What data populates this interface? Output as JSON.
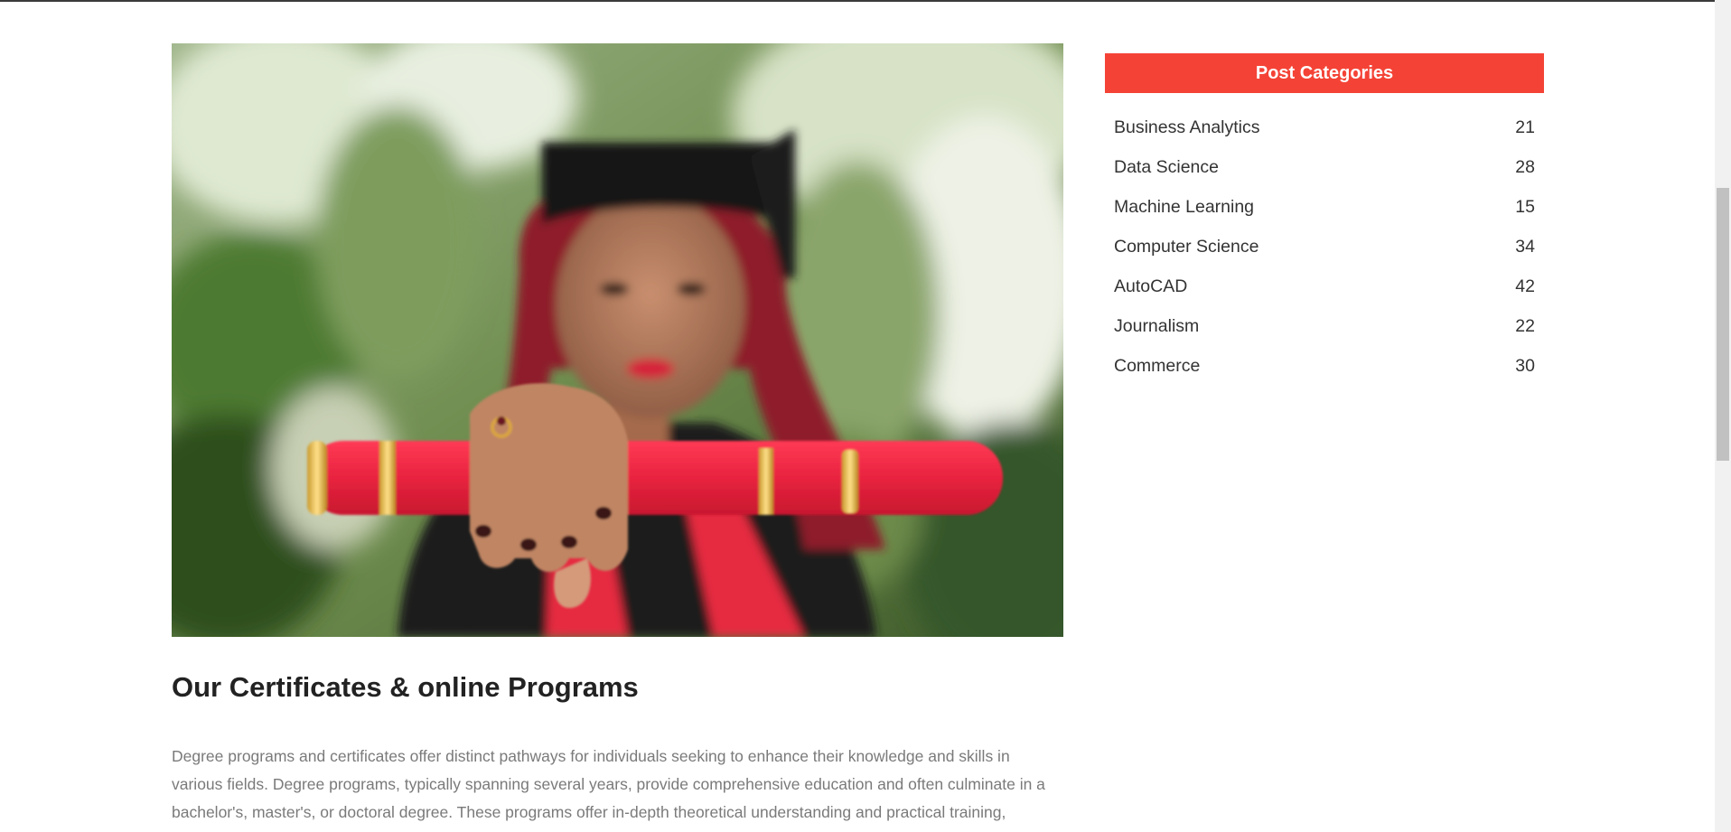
{
  "post": {
    "image_alt": "Graduate holding a red diploma scroll",
    "title": "Our Certificates & online Programs",
    "body": "Degree programs and certificates offer distinct pathways for individuals seeking to enhance their knowledge and skills in various fields. Degree programs, typically spanning several years, provide comprehensive education and often culminate in a bachelor's, master's, or doctoral degree. These programs offer in-depth theoretical understanding and practical training,"
  },
  "sidebar": {
    "header": "Post Categories",
    "categories": [
      {
        "label": "Business Analytics",
        "count": "21"
      },
      {
        "label": "Data Science",
        "count": "28"
      },
      {
        "label": "Machine Learning",
        "count": "15"
      },
      {
        "label": "Computer Science",
        "count": "34"
      },
      {
        "label": "AutoCAD",
        "count": "42"
      },
      {
        "label": "Journalism",
        "count": "22"
      },
      {
        "label": "Commerce",
        "count": "30"
      }
    ]
  },
  "colors": {
    "accent": "#f44336",
    "title": "#222222",
    "body_text": "#7a7a7a"
  }
}
